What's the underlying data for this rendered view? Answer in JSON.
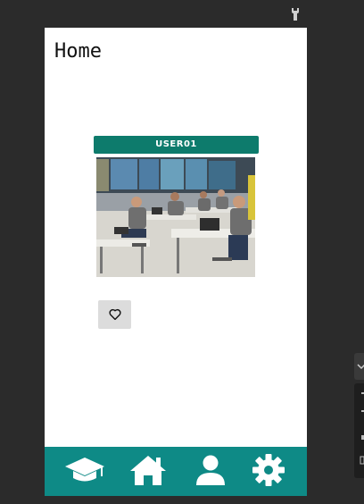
{
  "header": {
    "title": "Home"
  },
  "post": {
    "username": "USER01",
    "image_description": "classroom-with-students-at-laptops",
    "like_icon": "heart-outline-icon"
  },
  "bottom_nav": {
    "items": [
      {
        "name": "nav-courses",
        "icon": "graduation-cap-icon"
      },
      {
        "name": "nav-home",
        "icon": "home-icon"
      },
      {
        "name": "nav-profile",
        "icon": "person-icon"
      },
      {
        "name": "nav-settings",
        "icon": "gear-icon"
      }
    ]
  },
  "colors": {
    "nav_background": "#0e8a86",
    "badge_background": "#0d7b6c",
    "window_background": "#2b2b2b",
    "screen_background": "#ffffff"
  },
  "toolbar": {
    "icon": "wrench-icon"
  }
}
